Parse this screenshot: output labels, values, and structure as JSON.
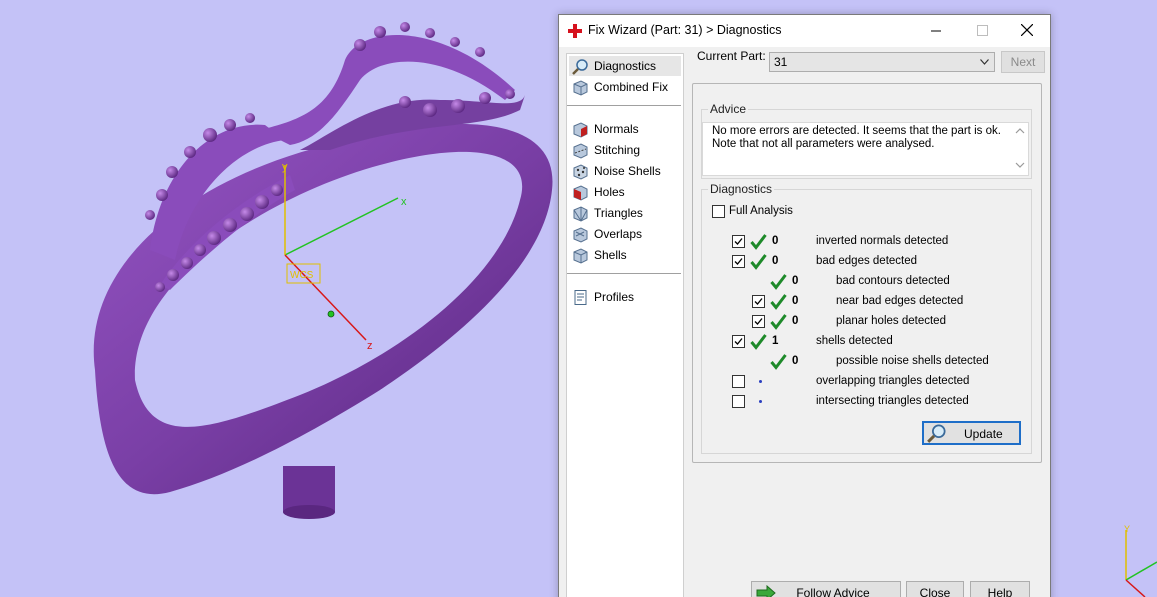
{
  "viewport": {
    "background_color": "#c4c2f7",
    "ring_color": "#7a3fa6",
    "axes": {
      "x_label": "x",
      "y_label": "y",
      "z_label": "z",
      "gizmo_label": "WCS",
      "corner_y_label": "Y"
    }
  },
  "dialog": {
    "title": "Fix Wizard (Part: 31) > Diagnostics",
    "title_icon": "red-cross-icon",
    "window_buttons": [
      "minimize-icon",
      "maximize-icon",
      "close-icon"
    ],
    "nav": {
      "top_items": [
        {
          "label": "Diagnostics",
          "icon": "magnifier-icon"
        },
        {
          "label": "Combined Fix",
          "icon": "cube-icon"
        }
      ],
      "fix_items": [
        {
          "label": "Normals",
          "icon": "normals-icon"
        },
        {
          "label": "Stitching",
          "icon": "stitching-icon"
        },
        {
          "label": "Noise Shells",
          "icon": "noise-shells-icon"
        },
        {
          "label": "Holes",
          "icon": "holes-icon"
        },
        {
          "label": "Triangles",
          "icon": "triangles-icon"
        },
        {
          "label": "Overlaps",
          "icon": "overlaps-icon"
        },
        {
          "label": "Shells",
          "icon": "shells-icon"
        }
      ],
      "bottom_items": [
        {
          "label": "Profiles",
          "icon": "profiles-icon"
        }
      ]
    },
    "current_part_label": "Current Part:",
    "current_part_value": "31",
    "next_button": "Next",
    "advice": {
      "title": "Advice",
      "line1": "No more errors are detected. It seems that the part is ok.",
      "line2": "Note that not all parameters were analysed."
    },
    "diagnostics": {
      "title": "Diagnostics",
      "full_analysis_label": "Full Analysis",
      "full_analysis_checked": false,
      "rows": [
        {
          "checkbox": true,
          "checked": true,
          "status": "ok",
          "count": "0",
          "label": "inverted normals detected",
          "indent": 0
        },
        {
          "checkbox": true,
          "checked": true,
          "status": "ok",
          "count": "0",
          "label": "bad edges detected",
          "indent": 0
        },
        {
          "checkbox": false,
          "checked": false,
          "status": "ok",
          "count": "0",
          "label": "bad contours detected",
          "indent": 1
        },
        {
          "checkbox": true,
          "checked": true,
          "status": "ok",
          "count": "0",
          "label": "near bad edges detected",
          "indent": 1
        },
        {
          "checkbox": true,
          "checked": true,
          "status": "ok",
          "count": "0",
          "label": "planar holes detected",
          "indent": 1
        },
        {
          "checkbox": true,
          "checked": true,
          "status": "ok",
          "count": "1",
          "label": "shells detected",
          "indent": 0
        },
        {
          "checkbox": false,
          "checked": false,
          "status": "ok",
          "count": "0",
          "label": "possible noise shells detected",
          "indent": 1
        },
        {
          "checkbox": true,
          "checked": false,
          "status": "pending",
          "count": "",
          "label": "overlapping triangles detected",
          "indent": 0
        },
        {
          "checkbox": true,
          "checked": false,
          "status": "pending",
          "count": "",
          "label": "intersecting triangles detected",
          "indent": 0
        }
      ],
      "update_button": "Update"
    },
    "buttons": {
      "follow_advice": "Follow Advice",
      "close": "Close",
      "help": "Help"
    }
  }
}
